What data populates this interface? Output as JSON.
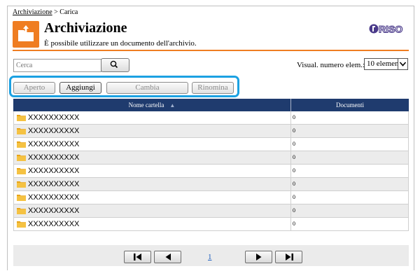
{
  "breadcrumb": {
    "parent": "Archiviazione",
    "separator": " > ",
    "current": "Carica"
  },
  "header": {
    "title": "Archiviazione",
    "description": "È possibile utilizzare un documento dell'archivio.",
    "app_icon": "folder-upload-icon",
    "logo_text": "RISO"
  },
  "search": {
    "placeholder": "Cerca",
    "icon": "search-icon"
  },
  "view": {
    "label": "Visual. numero elem.:",
    "selected": "10 elementi"
  },
  "toolbar": {
    "open": "Aperto",
    "add": "Aggiungi",
    "change": "Cambia",
    "rename": "Rinomina"
  },
  "table": {
    "columns": {
      "name": "Nome cartella",
      "documents": "Documenti"
    },
    "rows": [
      {
        "name": "XXXXXXXXXX",
        "documents": "0"
      },
      {
        "name": "XXXXXXXXXX",
        "documents": "0"
      },
      {
        "name": "XXXXXXXXXX",
        "documents": "0"
      },
      {
        "name": "XXXXXXXXXX",
        "documents": "0"
      },
      {
        "name": "XXXXXXXXXX",
        "documents": "0"
      },
      {
        "name": "XXXXXXXXXX",
        "documents": "0"
      },
      {
        "name": "XXXXXXXXXX",
        "documents": "0"
      },
      {
        "name": "XXXXXXXXXX",
        "documents": "0"
      },
      {
        "name": "XXXXXXXXXX",
        "documents": "0"
      }
    ]
  },
  "pager": {
    "current_page": "1"
  },
  "colors": {
    "accent": "#ef7d22",
    "header": "#1f3b6e",
    "highlight": "#1ba1e2",
    "folder": "#f5c242"
  }
}
